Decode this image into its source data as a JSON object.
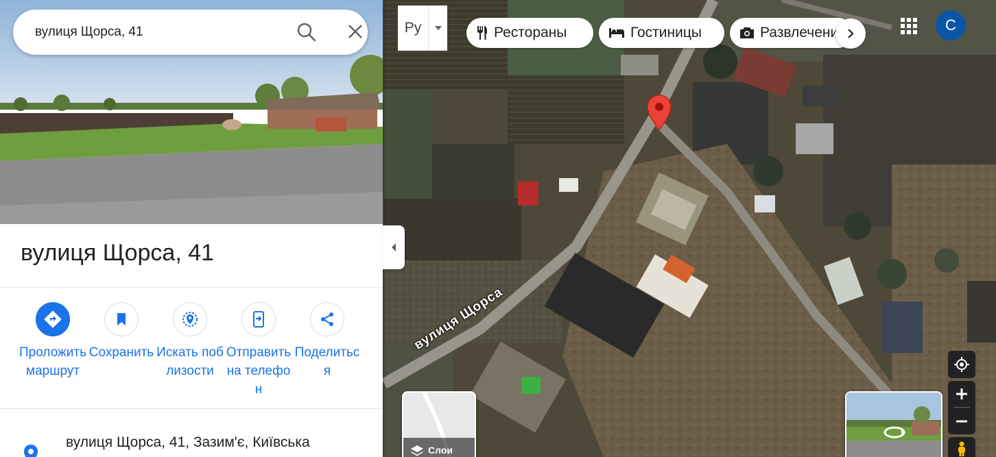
{
  "search": {
    "value": "вулиця Щорса, 41"
  },
  "place": {
    "title": "вулиця Щорса, 41",
    "address": "вулиця Щорса, 41, Зазим'є, Київська"
  },
  "actions": [
    {
      "label": "Проложить маршрут",
      "icon": "directions-icon"
    },
    {
      "label": "Сохранить",
      "icon": "bookmark-icon"
    },
    {
      "label": "Искать поблизости",
      "icon": "nearby-icon"
    },
    {
      "label": "Отправить на телефон",
      "icon": "send-to-phone-icon"
    },
    {
      "label": "Поделиться",
      "icon": "share-icon"
    }
  ],
  "input_tool": {
    "label": "Ру"
  },
  "chips": [
    {
      "label": "Рестораны",
      "icon": "restaurant-icon"
    },
    {
      "label": "Гостиницы",
      "icon": "hotel-icon"
    },
    {
      "label": "Развлечения",
      "icon": "camera-icon"
    }
  ],
  "user": {
    "avatar_letter": "C"
  },
  "map": {
    "road_label": "вулиця Щорса",
    "layers_label": "Слои"
  },
  "colors": {
    "accent": "#1a73e8",
    "pin": "#ea4335",
    "avatar": "#0b57a6"
  }
}
